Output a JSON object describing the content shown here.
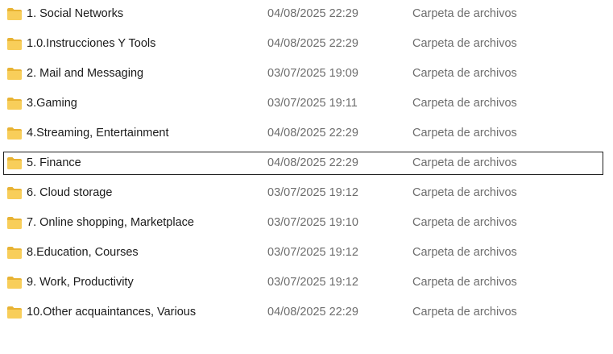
{
  "icon": "folder-icon",
  "colors": {
    "folder_body": "#F8CE5A",
    "folder_tab": "#E8B333",
    "selection_border": "#1F1F1F",
    "name_text": "#1B1B1B",
    "meta_text": "#6D6D6D"
  },
  "rows": [
    {
      "name": "1. Social Networks",
      "date": "04/08/2025 22:29",
      "type": "Carpeta de archivos",
      "selected": false
    },
    {
      "name": "1.0.Instrucciones Y Tools",
      "date": "04/08/2025 22:29",
      "type": "Carpeta de archivos",
      "selected": false
    },
    {
      "name": "2. Mail and Messaging",
      "date": "03/07/2025 19:09",
      "type": "Carpeta de archivos",
      "selected": false
    },
    {
      "name": "3.Gaming",
      "date": "03/07/2025 19:11",
      "type": "Carpeta de archivos",
      "selected": false
    },
    {
      "name": "4.Streaming, Entertainment",
      "date": "04/08/2025 22:29",
      "type": "Carpeta de archivos",
      "selected": false
    },
    {
      "name": "5. Finance",
      "date": "04/08/2025 22:29",
      "type": "Carpeta de archivos",
      "selected": true
    },
    {
      "name": "6. Cloud storage",
      "date": "03/07/2025 19:12",
      "type": "Carpeta de archivos",
      "selected": false
    },
    {
      "name": "7. Online shopping, Marketplace",
      "date": "03/07/2025 19:10",
      "type": "Carpeta de archivos",
      "selected": false
    },
    {
      "name": "8.Education, Courses",
      "date": "03/07/2025 19:12",
      "type": "Carpeta de archivos",
      "selected": false
    },
    {
      "name": "9. Work, Productivity",
      "date": "03/07/2025 19:12",
      "type": "Carpeta de archivos",
      "selected": false
    },
    {
      "name": "10.Other acquaintances, Various",
      "date": "04/08/2025 22:29",
      "type": "Carpeta de archivos",
      "selected": false
    }
  ]
}
